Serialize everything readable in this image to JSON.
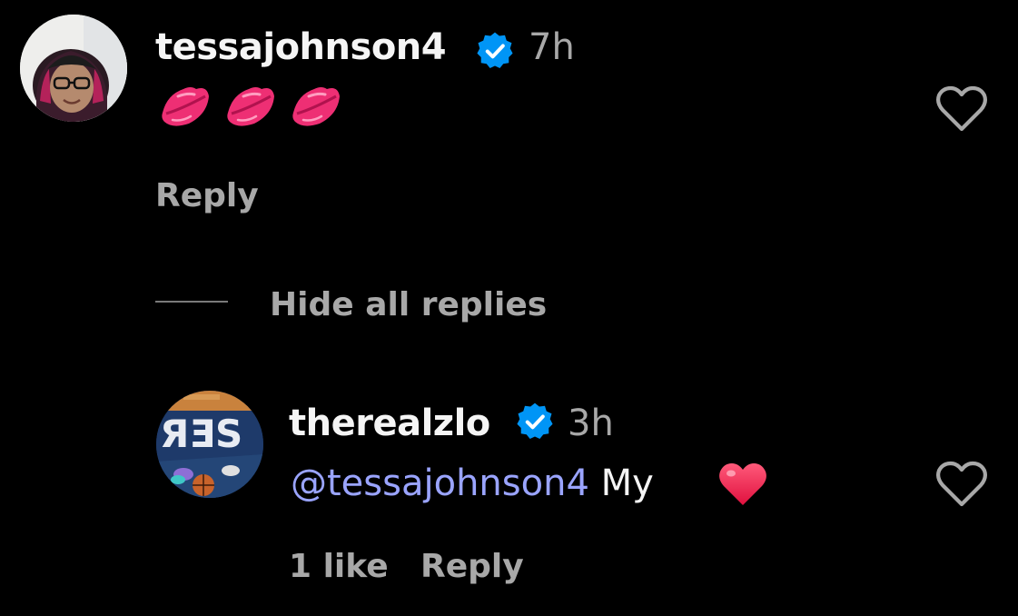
{
  "colors": {
    "background": "#000000",
    "text_primary": "#f5f5f5",
    "text_secondary": "#a8a8a8",
    "verified_blue": "#0095f6",
    "mention_color": "#9aa4ff",
    "divider_color": "#7a7a7a"
  },
  "comment": {
    "username": "tessajohnson4",
    "verified_icon": "verified-badge-icon",
    "time": "7h",
    "content_icons": [
      "kiss-mark-icon",
      "kiss-mark-icon",
      "kiss-mark-icon"
    ],
    "reply_label": "Reply",
    "like_icon": "heart-outline-icon"
  },
  "replies_toggle": {
    "label": "Hide all replies"
  },
  "reply": {
    "username": "therealzlo",
    "verified_icon": "verified-badge-icon",
    "time": "3h",
    "mention": "@tessajohnson4",
    "text": "My",
    "content_icon": "red-heart-icon",
    "likes_label": "1 like",
    "reply_label": "Reply",
    "like_icon": "heart-outline-icon"
  }
}
